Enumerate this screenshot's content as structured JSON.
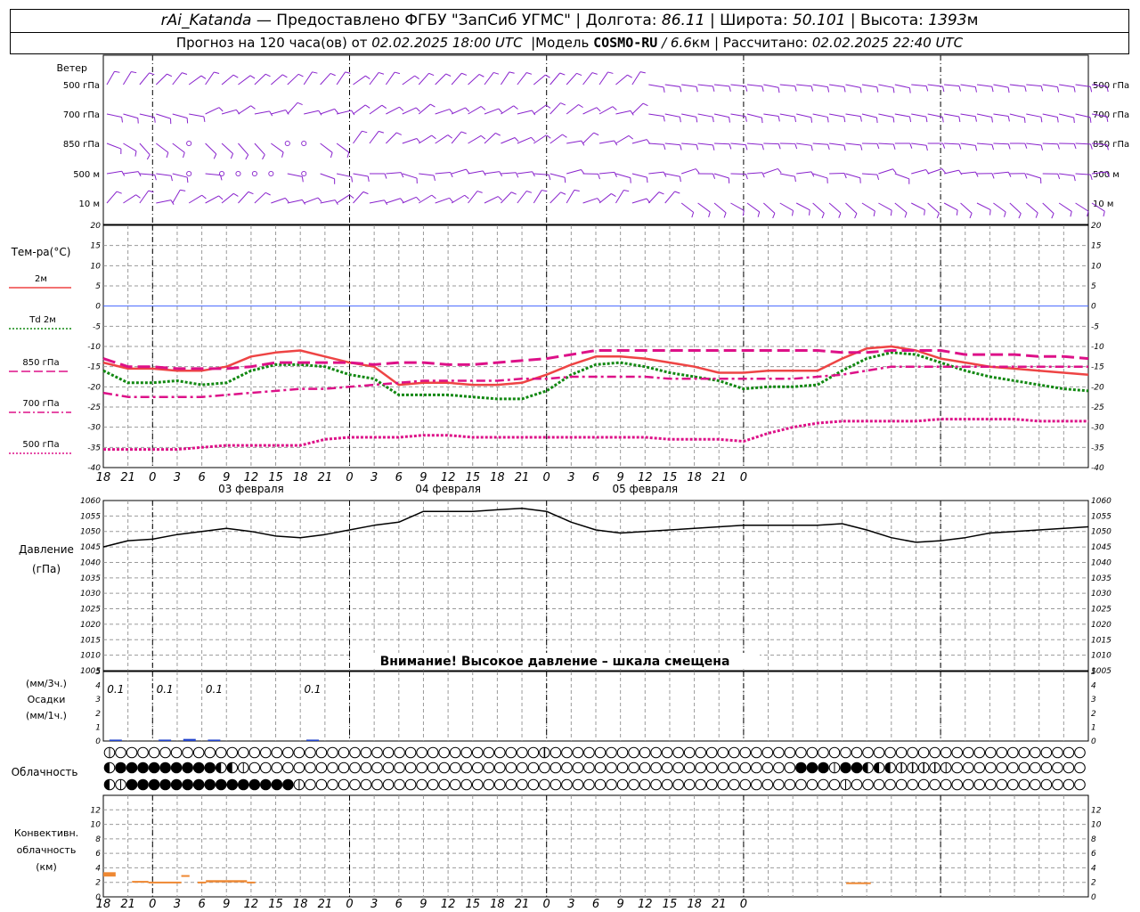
{
  "header": {
    "station": "rAi_Katanda",
    "provider": "— Предоставлено ФГБУ \"ЗапСиб УГМС\"",
    "lon_label": "Долгота:",
    "lon": "86.11",
    "lat_label": "Широта:",
    "lat": "50.101",
    "alt_label": "Высота:",
    "alt": "1393",
    "alt_unit": "м",
    "forecast_prefix": "Прогноз на 120 часа(ов) от",
    "forecast_start": "02.02.2025 18:00 UTC",
    "model_prefix": "Модель",
    "model_name": "COSMO-RU",
    "model_res": "/ 6.6",
    "model_res_unit": "км",
    "calc_label": "Рассчитано:",
    "calc_time": "02.02.2025 22:40 UTC"
  },
  "colors": {
    "t2m": "#ee4444",
    "td2m": "#118811",
    "t850": "#dd1188",
    "t700": "#dd1188",
    "t500": "#dd1188",
    "pressure": "#000000",
    "precip": "#2244cc",
    "conv": "#ee8833",
    "wind": "#8822cc",
    "zero_line": "#4466ff"
  },
  "chart_data": [
    {
      "type": "wind_barbs",
      "title": "Ветер",
      "levels": [
        "500 гПа",
        "700 гПа",
        "850 гПа",
        "500 м",
        "10 м"
      ]
    },
    {
      "type": "line",
      "ylabel": "Тем-ра(°C)",
      "ylim": [
        -40,
        20
      ],
      "yticks": [
        20,
        15,
        10,
        5,
        0,
        -5,
        -10,
        -15,
        -20,
        -25,
        -30,
        -35,
        -40
      ],
      "hours": [
        0,
        3,
        6,
        9,
        12,
        15,
        18,
        21,
        24,
        27,
        30,
        33,
        36,
        39,
        42,
        45,
        48,
        51,
        54,
        57,
        60,
        63,
        66,
        69,
        72,
        75,
        78,
        81,
        84,
        87,
        90,
        93,
        96,
        99,
        102,
        105,
        108,
        111,
        114,
        117,
        120
      ],
      "series": [
        {
          "name": "2м",
          "key": "t2m",
          "values": [
            -14,
            -15.5,
            -15.5,
            -16,
            -16,
            -15,
            -12.5,
            -11.5,
            -11,
            -12.5,
            -14,
            -15,
            -19.5,
            -19,
            -19,
            -19.5,
            -19.5,
            -19,
            -17,
            -14.5,
            -12.5,
            -12.5,
            -13,
            -14,
            -15,
            -16.5,
            -16.5,
            -16,
            -16,
            -16,
            -13,
            -10.5,
            -10,
            -11,
            -13,
            -14,
            -15,
            -15.5,
            -16,
            -16.5,
            -17
          ]
        },
        {
          "name": "Td 2м",
          "key": "td2m",
          "values": [
            -16,
            -19,
            -19,
            -18.5,
            -19.5,
            -19,
            -16,
            -14.5,
            -14.5,
            -15,
            -17,
            -18,
            -22,
            -22,
            -22,
            -22.5,
            -23,
            -23,
            -21,
            -17,
            -14.5,
            -14,
            -15,
            -16.5,
            -17.5,
            -18.5,
            -20.5,
            -20,
            -20,
            -19.5,
            -16,
            -13,
            -11.5,
            -12,
            -14,
            -16,
            -17.5,
            -18.5,
            -19.5,
            -20.5,
            -21
          ]
        },
        {
          "name": "850 гПа",
          "key": "t850",
          "values": [
            -13,
            -15,
            -15,
            -15.5,
            -15.5,
            -15.5,
            -15,
            -14,
            -14,
            -14,
            -14,
            -14.5,
            -14,
            -14,
            -14.5,
            -14.5,
            -14,
            -13.5,
            -13,
            -12,
            -11,
            -11,
            -11,
            -11,
            -11,
            -11,
            -11,
            -11,
            -11,
            -11,
            -11.5,
            -11.5,
            -11,
            -11,
            -11,
            -12,
            -12,
            -12,
            -12.5,
            -12.5,
            -13
          ]
        },
        {
          "name": "700 гПа",
          "key": "t700",
          "values": [
            -21.5,
            -22.5,
            -22.5,
            -22.5,
            -22.5,
            -22,
            -21.5,
            -21,
            -20.5,
            -20.5,
            -20,
            -19.5,
            -19,
            -18.5,
            -18.5,
            -18.5,
            -18.5,
            -18,
            -18,
            -17.5,
            -17.5,
            -17.5,
            -17.5,
            -18,
            -18,
            -18,
            -18,
            -18,
            -18,
            -17.5,
            -17,
            -16,
            -15,
            -15,
            -15,
            -15,
            -15,
            -15,
            -15,
            -15,
            -15
          ]
        },
        {
          "name": "500 гПа",
          "key": "t500",
          "values": [
            -35.5,
            -35.5,
            -35.5,
            -35.5,
            -35,
            -34.5,
            -34.5,
            -34.5,
            -34.5,
            -33,
            -32.5,
            -32.5,
            -32.5,
            -32,
            -32,
            -32.5,
            -32.5,
            -32.5,
            -32.5,
            -32.5,
            -32.5,
            -32.5,
            -32.5,
            -33,
            -33,
            -33,
            -33.5,
            -31.5,
            -30,
            -29,
            -28.5,
            -28.5,
            -28.5,
            -28.5,
            -28,
            -28,
            -28,
            -28,
            -28.5,
            -28.5,
            -28.5
          ]
        }
      ]
    },
    {
      "type": "line",
      "ylabel": "Давление",
      "yunit": "(гПа)",
      "ylim": [
        1005,
        1060
      ],
      "yticks": [
        1060,
        1055,
        1050,
        1045,
        1040,
        1035,
        1030,
        1025,
        1020,
        1015,
        1010,
        1005
      ],
      "warning": "Внимание! Высокое давление – шкала смещена",
      "series": [
        {
          "name": "Давление",
          "key": "pressure",
          "values": [
            1045,
            1047,
            1047.5,
            1049,
            1050,
            1051,
            1050,
            1048.5,
            1048,
            1049,
            1050.5,
            1052,
            1053,
            1056.5,
            1056.5,
            1056.5,
            1057,
            1057.5,
            1056.5,
            1053,
            1050.5,
            1049.5,
            1050,
            1050.5,
            1051,
            1051.5,
            1052,
            1052,
            1052,
            1052,
            1052.5,
            1050.5,
            1048,
            1046.5,
            1047,
            1048,
            1049.5,
            1050,
            1050.5,
            1051,
            1051.5
          ]
        }
      ]
    },
    {
      "type": "bar",
      "ylabel_top": "(мм/3ч.)",
      "ylabel_mid": "Осадки",
      "ylabel_bot": "(мм/1ч.)",
      "ylim": [
        0,
        5
      ],
      "yticks": [
        5,
        4,
        3,
        2,
        1,
        0
      ],
      "labels": [
        {
          "hour": 3,
          "text": "0.1"
        },
        {
          "hour": 9,
          "text": "0.1"
        },
        {
          "hour": 15,
          "text": "0.1"
        },
        {
          "hour": 27,
          "text": "0.1"
        }
      ],
      "bars": [
        {
          "hour": 3,
          "value": 0.1
        },
        {
          "hour": 9,
          "value": 0.1
        },
        {
          "hour": 12,
          "value": 0.15
        },
        {
          "hour": 15,
          "value": 0.1
        },
        {
          "hour": 27,
          "value": 0.1
        }
      ]
    },
    {
      "type": "table",
      "title": "Облачность",
      "symbols": [
        "1000000000000000000000000000000000000002000000000000000000000000000000000000000000000000",
        "3444444444331000000000000000000000000000000000000000000000000044414433322221000000000000000",
        "3144444444444444410000000000000000000000000000000000000000000000001000000000000000000000000"
      ]
    },
    {
      "type": "bar",
      "ylabel_top": "Конвективн.",
      "ylabel_mid": "облачность",
      "ylabel_bot": "(км)",
      "ylim": [
        0,
        14
      ],
      "yticks": [
        12,
        10,
        8,
        6,
        4,
        2,
        0
      ],
      "segments": [
        {
          "h0": 0,
          "h1": 1.5,
          "bottom": 2.8,
          "top": 3.4
        },
        {
          "h0": 3.5,
          "h1": 5.5,
          "bottom": 2.0,
          "top": 2.2
        },
        {
          "h0": 5.5,
          "h1": 9.5,
          "bottom": 1.9,
          "top": 2.1
        },
        {
          "h0": 9.5,
          "h1": 10.5,
          "bottom": 2.8,
          "top": 3.0
        },
        {
          "h0": 11.5,
          "h1": 12.5,
          "bottom": 1.9,
          "top": 2.1
        },
        {
          "h0": 12.5,
          "h1": 17.5,
          "bottom": 2.0,
          "top": 2.3
        },
        {
          "h0": 17.5,
          "h1": 18.5,
          "bottom": 1.9,
          "top": 2.1
        },
        {
          "h0": 90.5,
          "h1": 93.5,
          "bottom": 1.9,
          "top": 2.0
        }
      ]
    }
  ],
  "axis": {
    "hour_labels": [
      "18",
      "21",
      "0",
      "3",
      "6",
      "9",
      "12",
      "15",
      "18",
      "21",
      "0",
      "3",
      "6",
      "9",
      "12",
      "15",
      "18",
      "21",
      "0",
      "3",
      "6",
      "9",
      "12",
      "15",
      "18",
      "21",
      "0"
    ],
    "dates": [
      "03 февраля",
      "04 февраля",
      "05 февраля"
    ]
  }
}
